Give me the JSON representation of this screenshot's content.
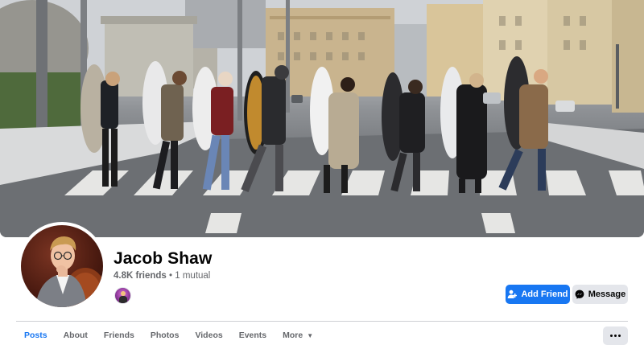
{
  "profile": {
    "name": "Jacob Shaw",
    "friends_count": "4.8K friends",
    "separator": " • ",
    "mutual": "1 mutual"
  },
  "actions": {
    "add_friend_label": "Add Friend",
    "message_label": "Message"
  },
  "tabs": [
    {
      "label": "Posts",
      "active": true
    },
    {
      "label": "About",
      "active": false
    },
    {
      "label": "Friends",
      "active": false
    },
    {
      "label": "Photos",
      "active": false
    },
    {
      "label": "Videos",
      "active": false
    },
    {
      "label": "Events",
      "active": false
    },
    {
      "label": "More",
      "active": false
    }
  ],
  "icons": {
    "add_friend": "person-plus-icon",
    "message": "messenger-icon",
    "more_dropdown": "caret-down-icon",
    "overflow": "ellipsis-icon"
  },
  "colors": {
    "brand_blue": "#1877f2",
    "secondary_button": "#e4e6eb",
    "muted_text": "#65676b"
  }
}
